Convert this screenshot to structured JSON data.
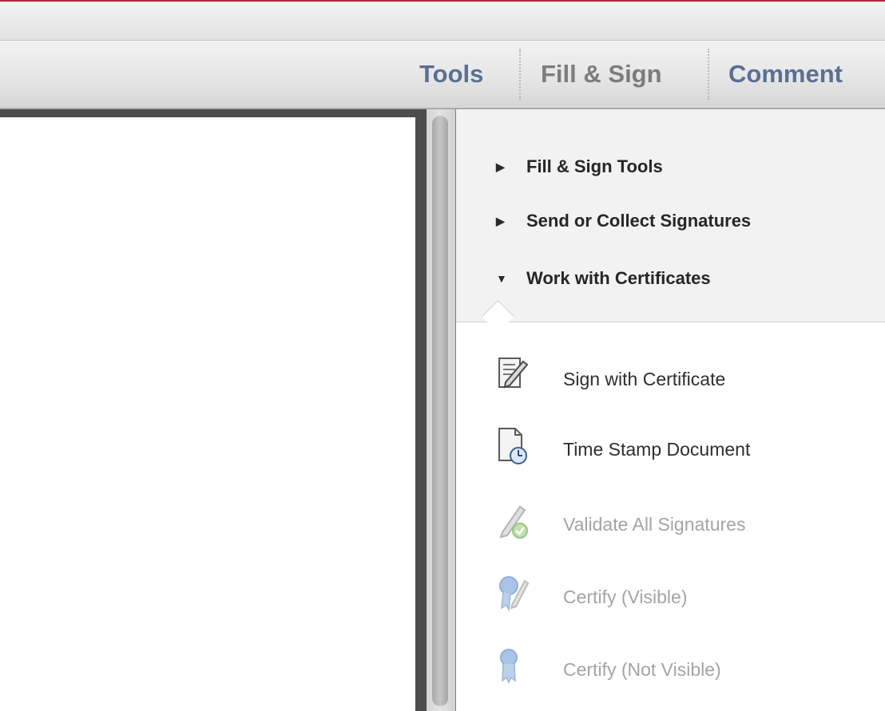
{
  "toolbar": {
    "tabs": [
      {
        "label": "Tools",
        "active": false
      },
      {
        "label": "Fill & Sign",
        "active": true
      },
      {
        "label": "Comment",
        "active": false
      }
    ]
  },
  "panel": {
    "sections": [
      {
        "label": "Fill & Sign Tools",
        "expanded": false,
        "arrow": "▶"
      },
      {
        "label": "Send or Collect Signatures",
        "expanded": false,
        "arrow": "▶"
      },
      {
        "label": "Work with Certificates",
        "expanded": true,
        "arrow": "▼"
      }
    ],
    "tools": [
      {
        "label": "Sign with Certificate",
        "icon": "sign-certificate-icon",
        "enabled": true
      },
      {
        "label": "Time Stamp Document",
        "icon": "time-stamp-icon",
        "enabled": true
      },
      {
        "label": "Validate All Signatures",
        "icon": "validate-signatures-icon",
        "enabled": false
      },
      {
        "label": "Certify (Visible)",
        "icon": "certify-visible-icon",
        "enabled": false
      },
      {
        "label": "Certify (Not Visible)",
        "icon": "certify-not-visible-icon",
        "enabled": false
      }
    ]
  },
  "colors": {
    "accent_red": "#b3283a",
    "tab_blue": "#5a6f93",
    "tab_active_gray": "#7c7c7c",
    "disabled_text": "#a4a4a4"
  }
}
